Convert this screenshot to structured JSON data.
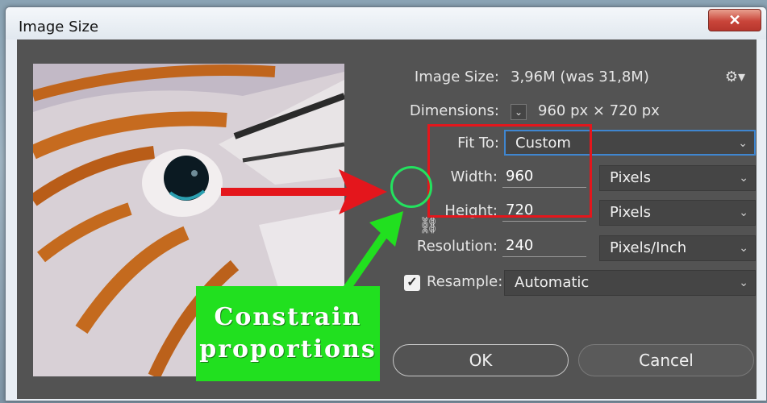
{
  "window": {
    "title": "Image Size",
    "close_label": "✕"
  },
  "info": {
    "image_size_label": "Image Size:",
    "image_size_value": "3,96M (was 31,8M)",
    "dimensions_label": "Dimensions:",
    "dimensions_value": "960 px  ×  720 px"
  },
  "fit_to": {
    "label": "Fit To:",
    "value": "Custom"
  },
  "width": {
    "label": "Width:",
    "value": "960",
    "unit": "Pixels"
  },
  "height": {
    "label": "Height:",
    "value": "720",
    "unit": "Pixels"
  },
  "resolution": {
    "label": "Resolution:",
    "value": "240",
    "unit": "Pixels/Inch"
  },
  "resample": {
    "label": "Resample:",
    "checked": true,
    "value": "Automatic"
  },
  "buttons": {
    "ok": "OK",
    "cancel": "Cancel"
  },
  "annotation": {
    "line1": "Constrain",
    "line2": "proportions"
  },
  "icons": {
    "gear": "gear-icon",
    "link": "chain-link-icon",
    "close": "close-icon"
  },
  "colors": {
    "annotation_red": "#e4161c",
    "annotation_green": "#21e01f",
    "highlight_blue": "#3f86d0",
    "dialog_bg": "#535353"
  }
}
